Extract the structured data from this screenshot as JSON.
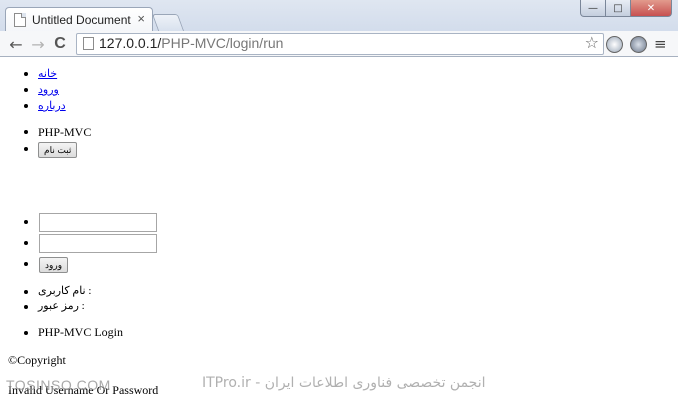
{
  "browser": {
    "tab_title": "Untitled Document",
    "tab_close": "×",
    "url_host": "127.0.0.1/",
    "url_path": "PHP-MVC/login/run",
    "back_glyph": "←",
    "forward_glyph": "→",
    "reload_glyph": "C",
    "star_glyph": "☆",
    "menu_glyph": "≡",
    "window_controls": {
      "minimize": "—",
      "maximize": "□",
      "close": "✕"
    }
  },
  "nav": {
    "items": [
      {
        "label": "خانه"
      },
      {
        "label": "ورود"
      },
      {
        "label": "درباره"
      }
    ]
  },
  "brand": {
    "name": "PHP-MVC",
    "register_button": "ثبت نام"
  },
  "login_form": {
    "username_value": "",
    "password_value": "",
    "submit_label": "ورود"
  },
  "labels": {
    "username": "نام کاربری :",
    "password": "رمز عبور :"
  },
  "page": {
    "login_title": "PHP-MVC Login",
    "copyright": "©Copyright",
    "error_message": "Invalid Username Or Password"
  },
  "watermark": {
    "left": "TOSINSO.COM",
    "right": "ITPro.ir - انجمن تخصصی فناوری اطلاعات ایران"
  }
}
